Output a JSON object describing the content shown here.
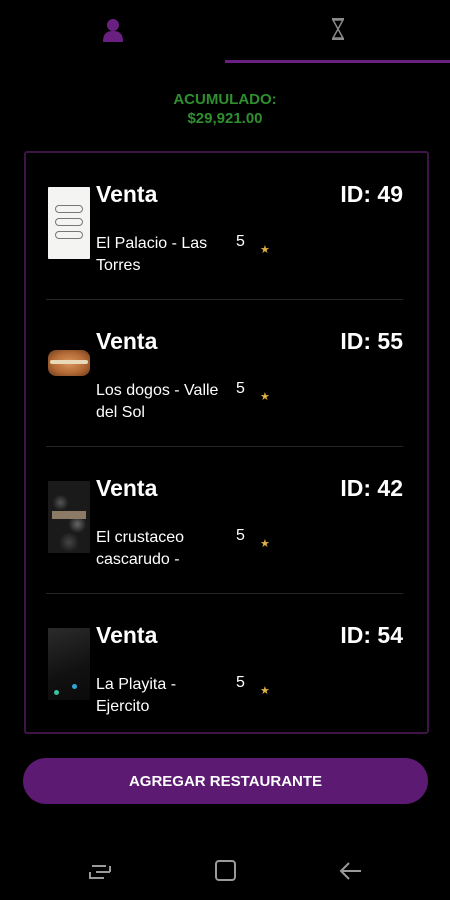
{
  "tabs": [
    {
      "icon": "person-icon"
    },
    {
      "icon": "hourglass-icon",
      "glyph": "⌛"
    }
  ],
  "summary": {
    "label": "ACUMULADO:",
    "amount": "$29,921.00"
  },
  "sales": [
    {
      "title": "Venta",
      "id_label": "ID: 49",
      "restaurant": "El Palacio - Las Torres",
      "rating": "5",
      "star": "★",
      "thumb": "menu-image"
    },
    {
      "title": "Venta",
      "id_label": "ID: 55",
      "restaurant": "Los dogos - Valle del Sol",
      "rating": "5",
      "star": "★",
      "thumb": "hotdog-image"
    },
    {
      "title": "Venta",
      "id_label": "ID: 42",
      "restaurant": "El crustaceo cascarudo -",
      "rating": "5",
      "star": "★",
      "thumb": "restaurant-image"
    },
    {
      "title": "Venta",
      "id_label": "ID: 54",
      "restaurant": "La Playita - Ejercito",
      "rating": "5",
      "star": "★",
      "thumb": "night-image"
    }
  ],
  "actions": {
    "add_label": "AGREGAR RESTAURANTE"
  },
  "navbar": {
    "icons": [
      "recent-apps-icon",
      "home-icon",
      "back-icon"
    ]
  },
  "colors": {
    "accent": "#5c1a73",
    "tab_indicator": "#6a2080",
    "total_text": "#2f8f2f",
    "star": "#e0b040",
    "background": "#000000"
  }
}
